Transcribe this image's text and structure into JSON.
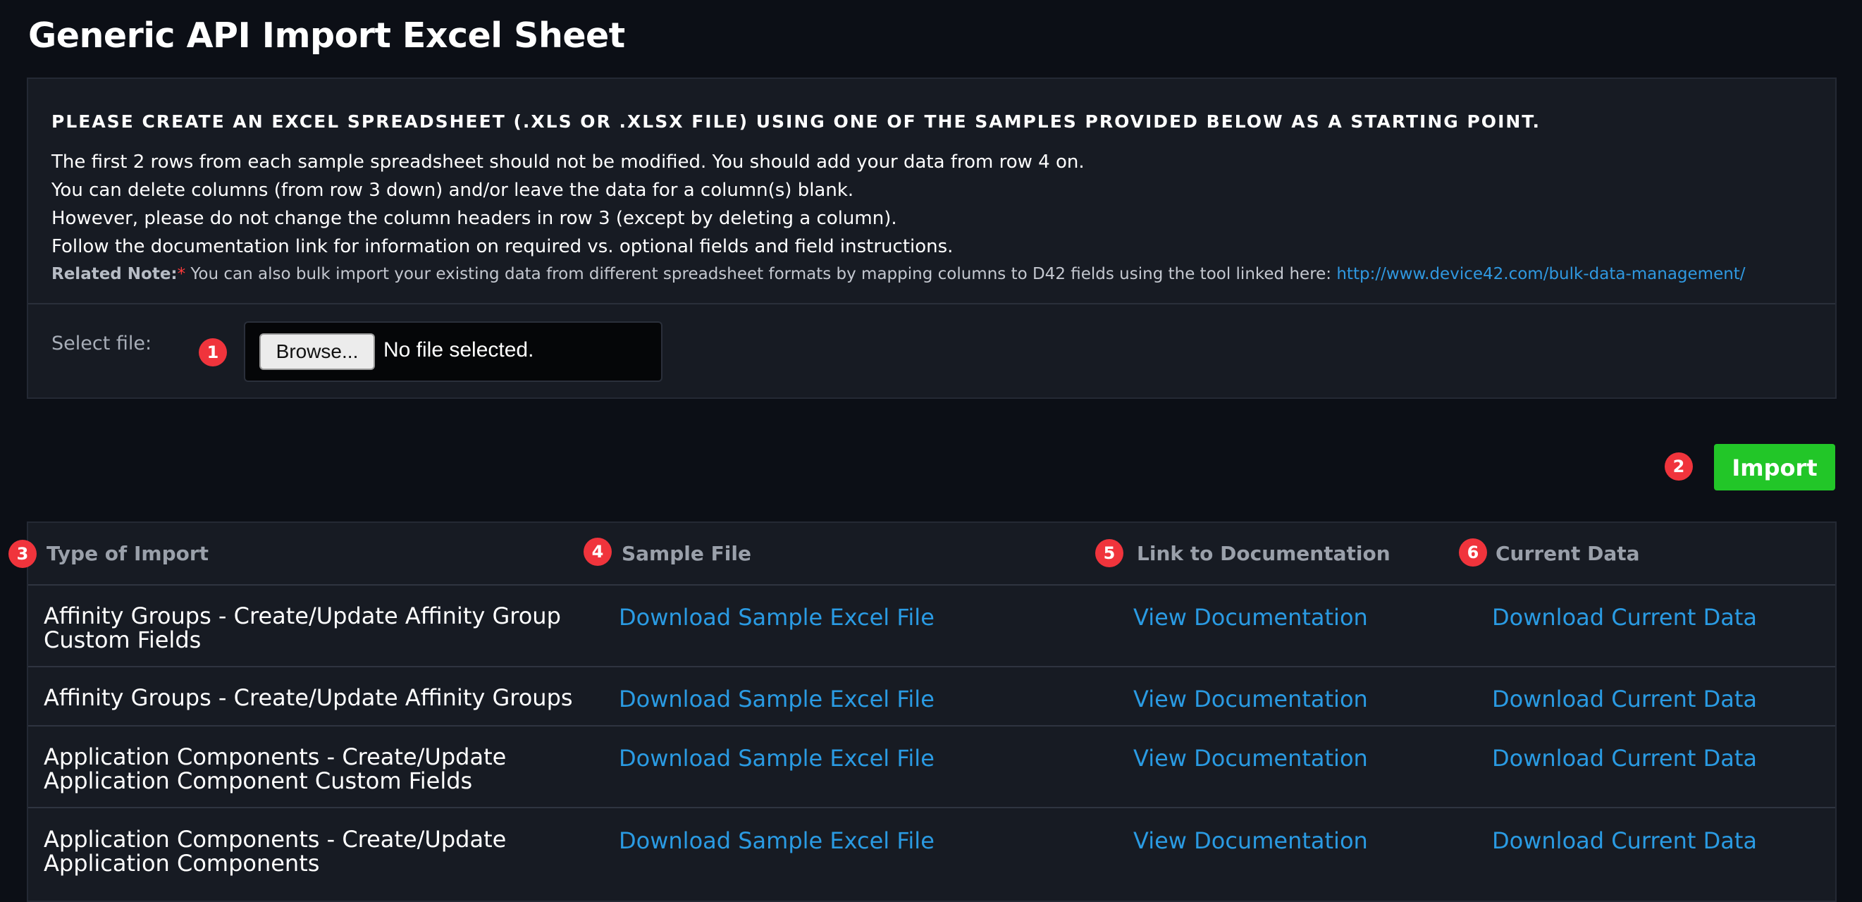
{
  "page": {
    "title": "Generic API Import Excel Sheet"
  },
  "info": {
    "heading": "PLEASE CREATE AN EXCEL SPREADSHEET (.XLS OR .XLSX FILE) USING ONE OF THE SAMPLES PROVIDED BELOW AS A STARTING POINT.",
    "lines": [
      "The first 2 rows from each sample spreadsheet should not be modified. You should add your data from row 4 on.",
      "You can delete columns (from row 3 down) and/or leave the data for a column(s) blank.",
      "However, please do not change the column headers in row 3 (except by deleting a column).",
      "Follow the documentation link for information on required vs. optional fields and field instructions."
    ],
    "note_label": "Related Note:",
    "note_asterisk": "*",
    "note_text": " You can also bulk import your existing data from different spreadsheet formats by mapping columns to D42 fields using the tool linked here: ",
    "note_link": "http://www.device42.com/bulk-data-management/"
  },
  "file_select": {
    "label": "Select file:",
    "browse_label": "Browse...",
    "status": "No file selected."
  },
  "import_button": {
    "label": "Import"
  },
  "markers": [
    "1",
    "2",
    "3",
    "4",
    "5",
    "6"
  ],
  "table": {
    "headers": [
      "Type of Import",
      "Sample File",
      "Link to Documentation",
      "Current Data"
    ],
    "rows": [
      {
        "type": "Affinity Groups - Create/Update Affinity Group Custom Fields",
        "sample": "Download Sample Excel File",
        "docs": "View Documentation",
        "current": "Download Current Data"
      },
      {
        "type": "Affinity Groups - Create/Update Affinity Groups",
        "sample": "Download Sample Excel File",
        "docs": "View Documentation",
        "current": "Download Current Data"
      },
      {
        "type": "Application Components - Create/Update Application Component Custom Fields",
        "sample": "Download Sample Excel File",
        "docs": "View Documentation",
        "current": "Download Current Data"
      },
      {
        "type": "Application Components - Create/Update Application Components",
        "sample": "Download Sample Excel File",
        "docs": "View Documentation",
        "current": "Download Current Data"
      }
    ]
  },
  "colors": {
    "background": "#0c0f16",
    "panel": "#171b23",
    "link": "#2a9be3",
    "import_button": "#22c628",
    "marker": "#f0343c"
  }
}
